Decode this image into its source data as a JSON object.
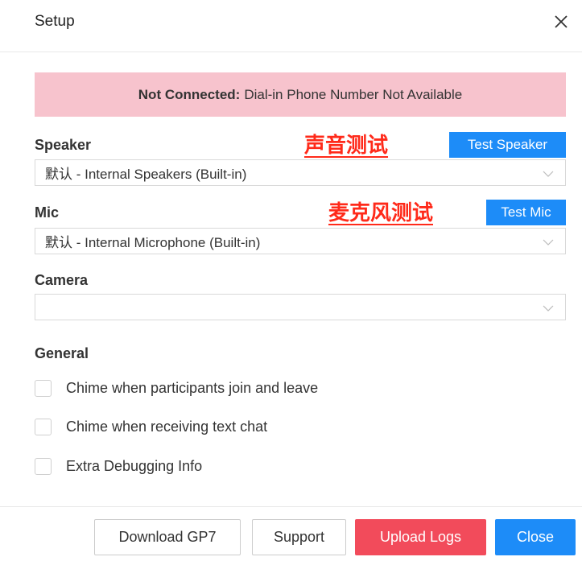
{
  "dialog": {
    "title": "Setup",
    "close_icon": "close-icon"
  },
  "banner": {
    "bold": "Not Connected:",
    "text": "Dial-in Phone Number Not Available",
    "background": "#f7c3cd"
  },
  "speaker": {
    "label": "Speaker",
    "annotation": "声音测试",
    "test_button": "Test Speaker",
    "selected": "默认 - Internal Speakers (Built-in)"
  },
  "mic": {
    "label": "Mic",
    "annotation": "麦克风测试",
    "test_button": "Test Mic",
    "selected": "默认 - Internal Microphone (Built-in)"
  },
  "camera": {
    "label": "Camera",
    "selected": ""
  },
  "general": {
    "label": "General",
    "options": [
      {
        "label": "Chime when participants join and leave",
        "checked": false
      },
      {
        "label": "Chime when receiving text chat",
        "checked": false
      },
      {
        "label": "Extra Debugging Info",
        "checked": false
      }
    ]
  },
  "footer": {
    "download": "Download GP7",
    "support": "Support",
    "upload_logs": "Upload Logs",
    "close": "Close"
  },
  "colors": {
    "primary": "#1d8cf8",
    "danger": "#f24b5b",
    "annotation": "#ff2a1a"
  }
}
